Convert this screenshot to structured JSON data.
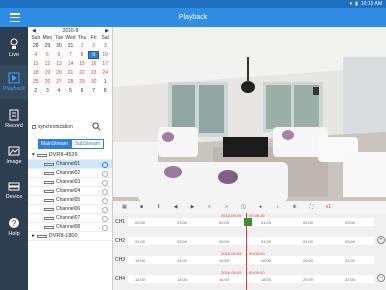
{
  "status": {
    "time": "10:15 AM"
  },
  "title": "Playback",
  "nav": [
    {
      "label": "Live",
      "icon": "live-icon"
    },
    {
      "label": "Playback",
      "icon": "playback-icon"
    },
    {
      "label": "Record",
      "icon": "record-icon"
    },
    {
      "label": "Image",
      "icon": "image-icon"
    },
    {
      "label": "Device",
      "icon": "device-icon"
    },
    {
      "label": "Help",
      "icon": "help-icon"
    }
  ],
  "calendar": {
    "month_label": "2016-9",
    "weekdays": [
      "Sun",
      "Mon",
      "Tue",
      "Wed",
      "Thu",
      "Fri",
      "Sat"
    ],
    "days": [
      [
        "28",
        "29",
        "30",
        "31",
        "1",
        "2",
        "3"
      ],
      [
        "4",
        "5",
        "6",
        "7",
        "8",
        "9",
        "10"
      ],
      [
        "11",
        "12",
        "13",
        "14",
        "15",
        "16",
        "17"
      ],
      [
        "18",
        "19",
        "20",
        "21",
        "22",
        "23",
        "24"
      ],
      [
        "25",
        "26",
        "27",
        "28",
        "29",
        "30",
        "1"
      ],
      [
        "2",
        "3",
        "4",
        "5",
        "6",
        "7",
        "8"
      ]
    ],
    "selected": "9"
  },
  "sync_label": "synchronization",
  "streams": {
    "main": "MainStream",
    "sub": "SubStream"
  },
  "devices": [
    {
      "name": "DVR8-4526"
    },
    {
      "name": "DVR8-1800"
    }
  ],
  "channels": [
    "Channel01",
    "Channel02",
    "Channel03",
    "Channel04",
    "Channel05",
    "Channel06",
    "Channel07",
    "Channel08"
  ],
  "timeline": {
    "tracks": [
      {
        "label": "CH1",
        "date": "2016-09-09",
        "cursor_time": "00:36:15",
        "times": [
          "22:00",
          "23:00",
          "00:00",
          "01:00",
          "02:00",
          "03:00"
        ]
      },
      {
        "label": "CH2",
        "date": "",
        "cursor_time": "",
        "times": [
          "22:00",
          "23:00",
          "00:00",
          "01:00",
          "02:00",
          "03:00"
        ]
      },
      {
        "label": "CH3",
        "date": "2016-09-09",
        "cursor_time": "00:00:00",
        "times": [
          "12:00",
          "14:00",
          "16:00",
          "18:00",
          "20:00",
          "22:00"
        ]
      },
      {
        "label": "CH4",
        "date": "2016-09-09",
        "cursor_time": "00:00:00",
        "times": [
          "12:00",
          "14:00",
          "16:00",
          "18:00",
          "20:00",
          "22:00"
        ]
      }
    ],
    "toolbar_text": "x1"
  }
}
